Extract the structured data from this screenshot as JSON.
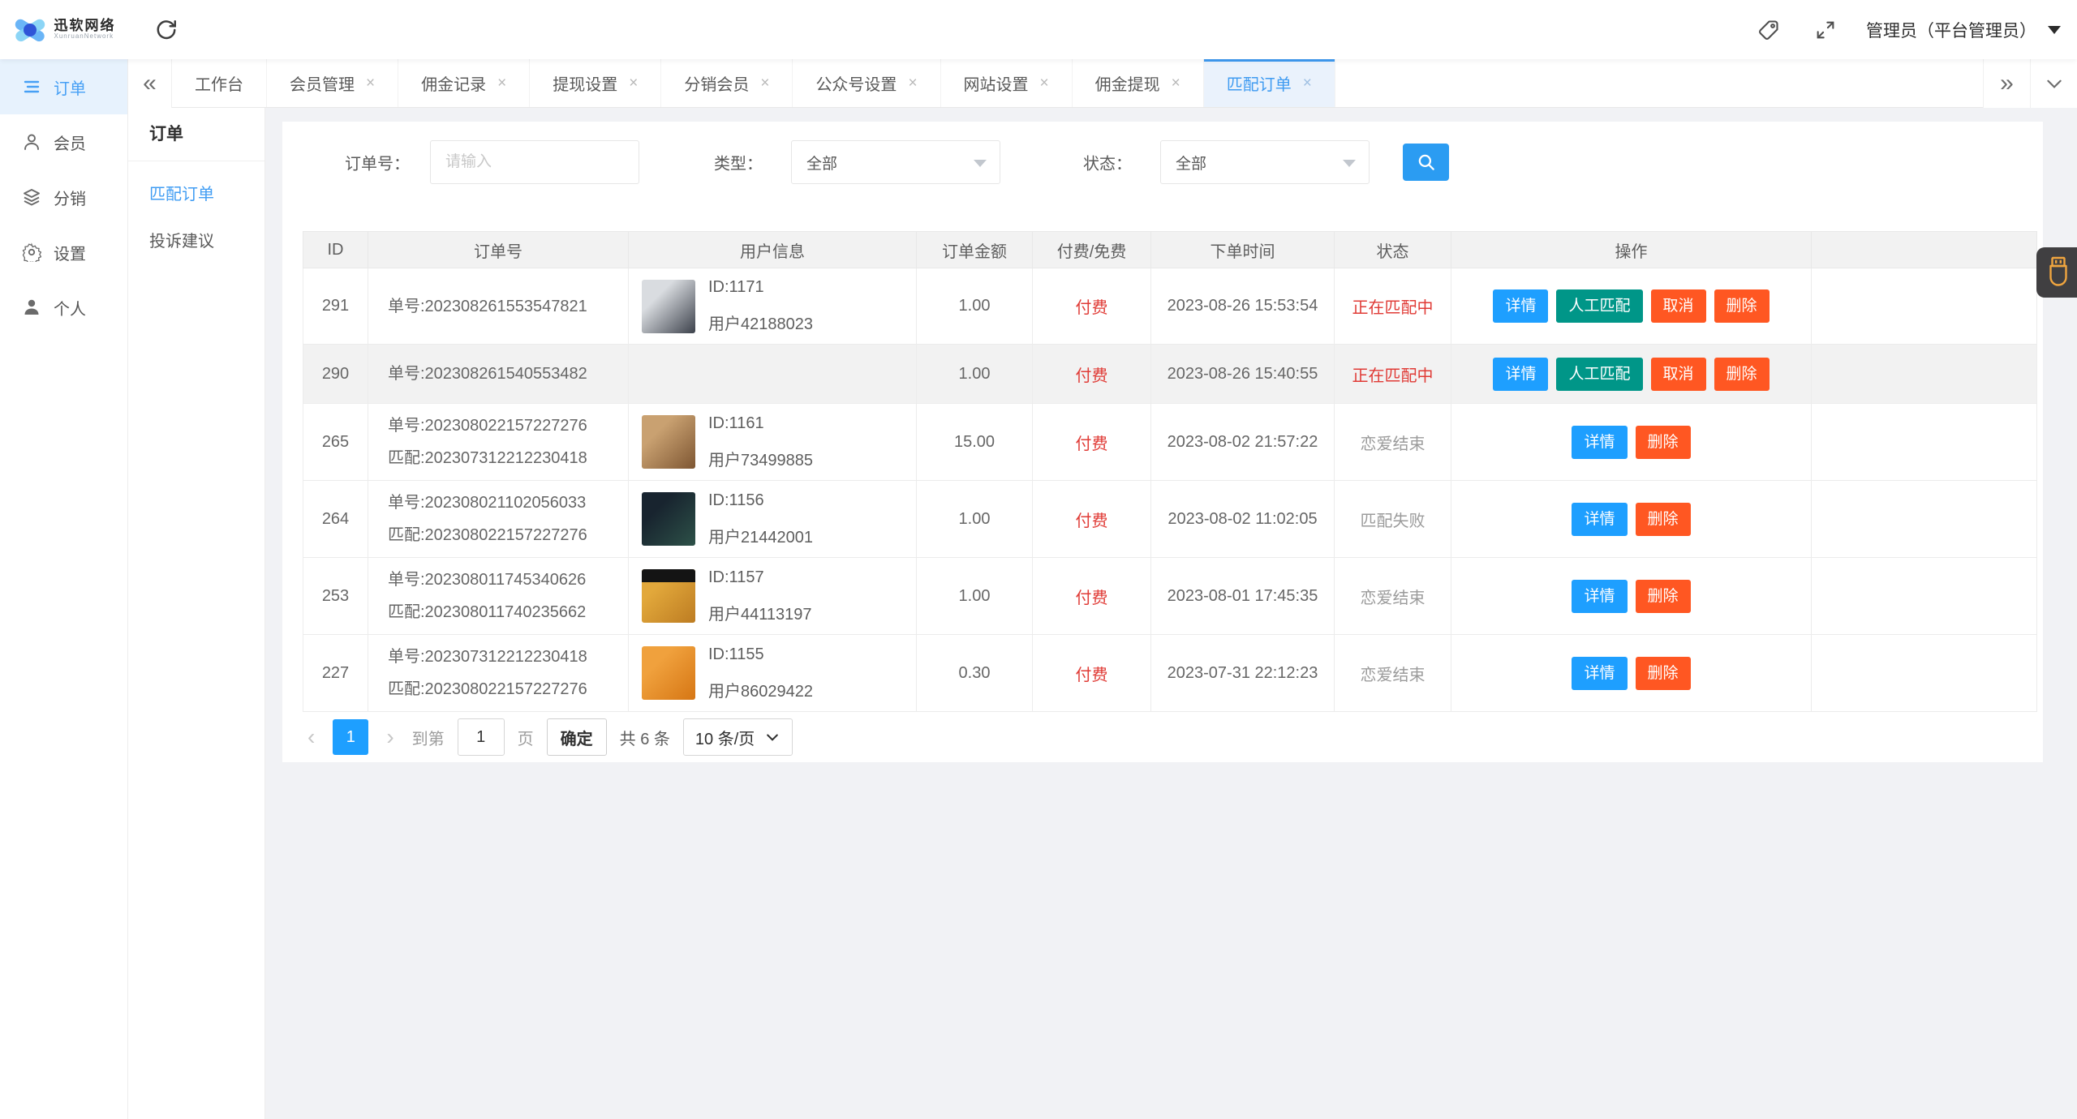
{
  "colors": {
    "accent_blue": "#1E9FFF",
    "search_blue": "#2b9cf2",
    "green": "#009688",
    "orange": "#FF5722",
    "red_text": "#e03b36",
    "tab_active_bg": "#eaf2fc",
    "tab_active_text": "#3f9bf1",
    "header_bg": "#f2f2f2",
    "widget_bg": "#403f41",
    "widget_icon": "#f0a53f"
  },
  "icons": {
    "logo": "x-mark-logo",
    "refresh": "circular-arrow",
    "tag": "price-tag-outline",
    "fullscreen": "expand-arrows",
    "user_caret": "filled-triangle-down",
    "collapse": "double-angle-left",
    "more_tabs": "double-angle-right",
    "tab_menu": "chevron-down",
    "search": "magnifier",
    "per_page_caret": "chevron-down",
    "float_widget": "usb-drive-outline"
  },
  "topbar": {
    "brand": "迅软网络",
    "brand_sub": "XunruanNetwork",
    "user_name": "管理员（平台管理员）"
  },
  "sidebar": {
    "items": [
      {
        "label": "订单",
        "icon": "order-list-icon",
        "active": true
      },
      {
        "label": "会员",
        "icon": "member-person-icon",
        "active": false
      },
      {
        "label": "分销",
        "icon": "distribution-layers-icon",
        "active": false
      },
      {
        "label": "设置",
        "icon": "settings-gear-icon",
        "active": false
      },
      {
        "label": "个人",
        "icon": "profile-person-icon",
        "active": false
      }
    ]
  },
  "tabs": {
    "items": [
      {
        "label": "工作台",
        "closable": false,
        "active": false
      },
      {
        "label": "会员管理",
        "closable": true,
        "active": false
      },
      {
        "label": "佣金记录",
        "closable": true,
        "active": false
      },
      {
        "label": "提现设置",
        "closable": true,
        "active": false
      },
      {
        "label": "分销会员",
        "closable": true,
        "active": false
      },
      {
        "label": "公众号设置",
        "closable": true,
        "active": false
      },
      {
        "label": "网站设置",
        "closable": true,
        "active": false
      },
      {
        "label": "佣金提现",
        "closable": true,
        "active": false
      },
      {
        "label": "匹配订单",
        "closable": true,
        "active": true
      }
    ]
  },
  "submenu": {
    "title": "订单",
    "items": [
      {
        "label": "匹配订单",
        "active": true
      },
      {
        "label": "投诉建议",
        "active": false
      }
    ]
  },
  "filters": {
    "order_no": {
      "label": "订单号：",
      "placeholder": "请输入"
    },
    "type": {
      "label": "类型：",
      "value": "全部"
    },
    "status": {
      "label": "状态：",
      "value": "全部"
    }
  },
  "table": {
    "headers": [
      "ID",
      "订单号",
      "用户信息",
      "订单金额",
      "付费/免费",
      "下单时间",
      "状态",
      "操作",
      ""
    ],
    "action_defs": {
      "detail": {
        "label": "详情",
        "color": "#1E9FFF"
      },
      "manual": {
        "label": "人工匹配",
        "color": "#009688"
      },
      "cancel": {
        "label": "取消",
        "color": "#FF5722"
      },
      "delete": {
        "label": "删除",
        "color": "#FF5722"
      }
    },
    "rows": [
      {
        "id": "291",
        "order_lines": [
          "单号:202308261553547821"
        ],
        "user": {
          "id_label": "ID:1171",
          "user_label": "用户42188023",
          "avatar_colors": [
            "#d9dce0",
            "#3c414b"
          ]
        },
        "amount": "1.00",
        "pay": "付费",
        "time": "2023-08-26 15:53:54",
        "status": "正在匹配中",
        "status_style": "red",
        "actions": [
          "detail",
          "manual",
          "cancel",
          "delete"
        ],
        "shaded": false
      },
      {
        "id": "290",
        "order_lines": [
          "单号:202308261540553482"
        ],
        "user": null,
        "amount": "1.00",
        "pay": "付费",
        "time": "2023-08-26 15:40:55",
        "status": "正在匹配中",
        "status_style": "red",
        "actions": [
          "detail",
          "manual",
          "cancel",
          "delete"
        ],
        "shaded": true
      },
      {
        "id": "265",
        "order_lines": [
          "单号:202308022157227276",
          "匹配:202307312212230418"
        ],
        "user": {
          "id_label": "ID:1161",
          "user_label": "用户73499885",
          "avatar_colors": [
            "#c9a171",
            "#7e5632"
          ]
        },
        "amount": "15.00",
        "pay": "付费",
        "time": "2023-08-02 21:57:22",
        "status": "恋爱结束",
        "status_style": "gray",
        "actions": [
          "detail",
          "delete"
        ],
        "shaded": false
      },
      {
        "id": "264",
        "order_lines": [
          "单号:202308021102056033",
          "匹配:202308022157227276"
        ],
        "user": {
          "id_label": "ID:1156",
          "user_label": "用户21442001",
          "avatar_colors": [
            "#18242f",
            "#2d5148"
          ]
        },
        "amount": "1.00",
        "pay": "付费",
        "time": "2023-08-02 11:02:05",
        "status": "匹配失败",
        "status_style": "gray",
        "actions": [
          "detail",
          "delete"
        ],
        "shaded": false
      },
      {
        "id": "253",
        "order_lines": [
          "单号:202308011745340626",
          "匹配:202308011740235662"
        ],
        "user": {
          "id_label": "ID:1157",
          "user_label": "用户44113197",
          "avatar_colors": [
            "#e2a83b",
            "#bd7c22"
          ],
          "avatar_banner": "#141414"
        },
        "amount": "1.00",
        "pay": "付费",
        "time": "2023-08-01 17:45:35",
        "status": "恋爱结束",
        "status_style": "gray",
        "actions": [
          "detail",
          "delete"
        ],
        "shaded": false
      },
      {
        "id": "227",
        "order_lines": [
          "单号:202307312212230418",
          "匹配:202308022157227276"
        ],
        "user": {
          "id_label": "ID:1155",
          "user_label": "用户86029422",
          "avatar_colors": [
            "#f0a13d",
            "#d67614"
          ]
        },
        "amount": "0.30",
        "pay": "付费",
        "time": "2023-07-31 22:12:23",
        "status": "恋爱结束",
        "status_style": "gray",
        "actions": [
          "detail",
          "delete"
        ],
        "shaded": false
      }
    ]
  },
  "pagination": {
    "current_page": "1",
    "goto_label": "到第",
    "page_value": "1",
    "page_unit": "页",
    "confirm_label": "确定",
    "total_label": "共 6 条",
    "per_page_label": "10 条/页"
  }
}
